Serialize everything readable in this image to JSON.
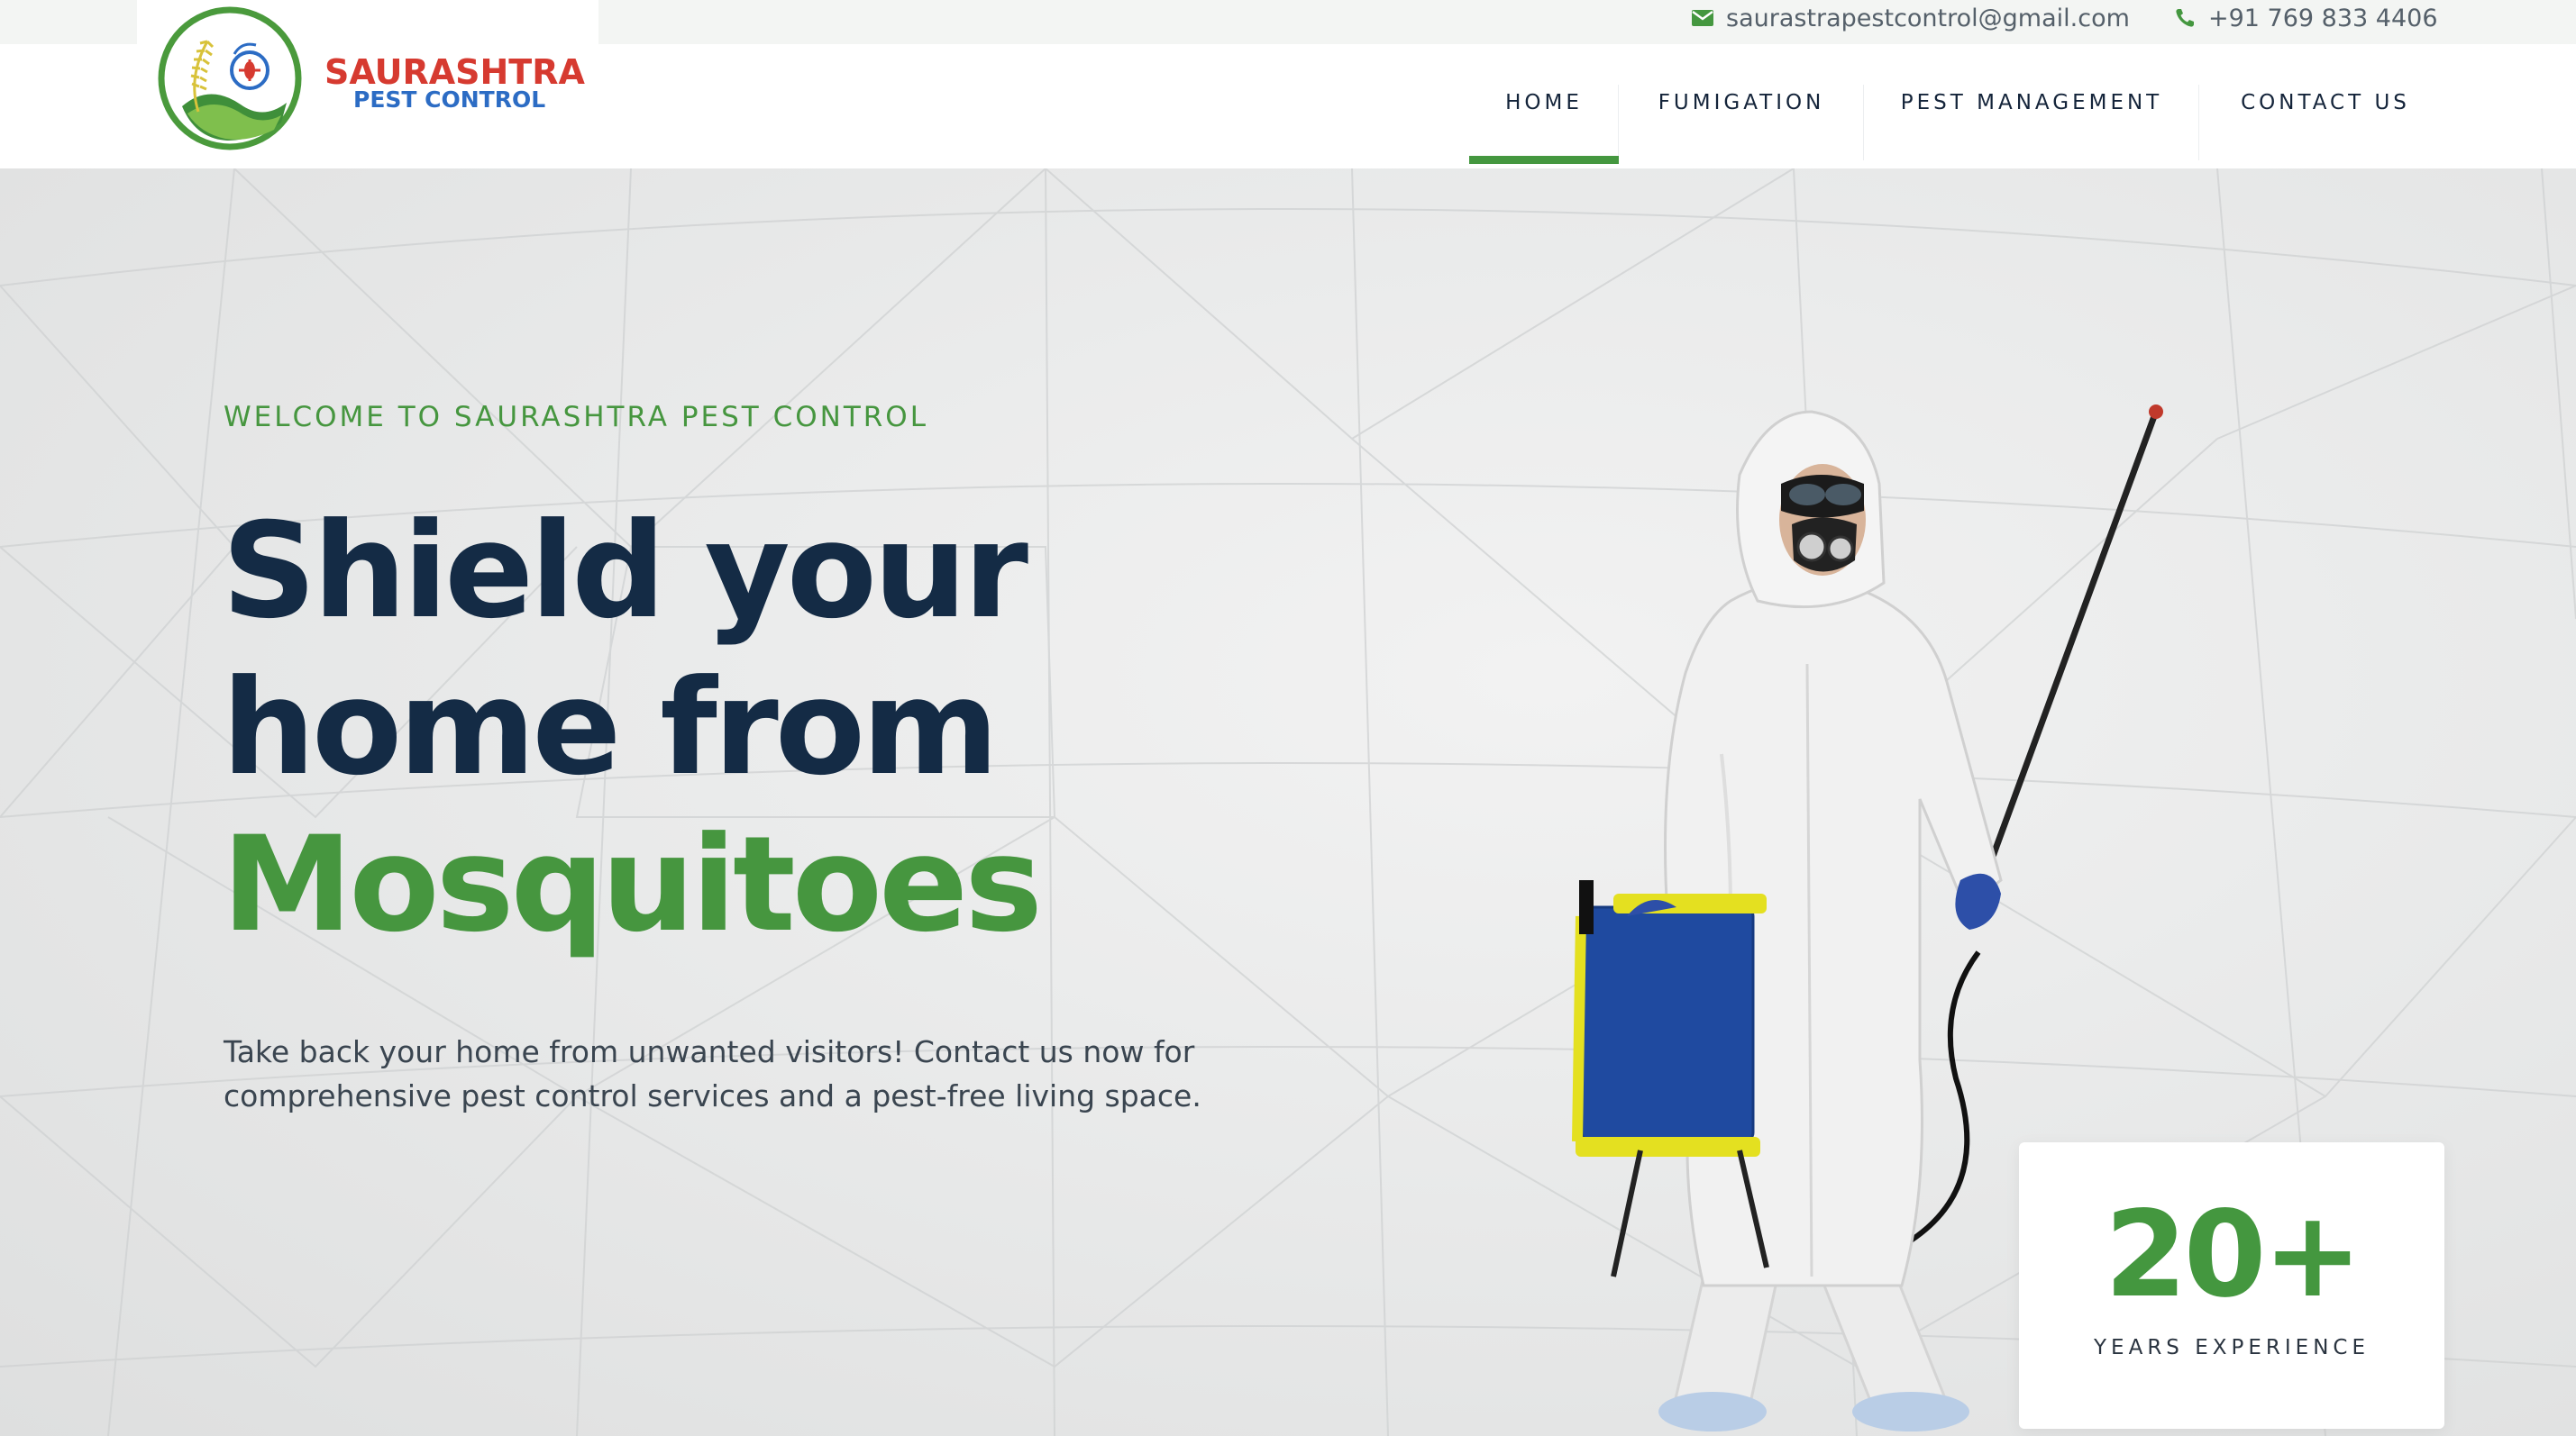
{
  "topbar": {
    "email": "saurastrapestcontrol@gmail.com",
    "phone": "+91 769 833 4406",
    "icons": {
      "email": "envelope-icon",
      "phone": "phone-icon"
    }
  },
  "logo": {
    "line1": "SAURASHTRA",
    "line2": "PEST CONTROL"
  },
  "nav": {
    "items": [
      {
        "label": "HOME",
        "active": true
      },
      {
        "label": "FUMIGATION",
        "active": false
      },
      {
        "label": "PEST MANAGEMENT",
        "active": false
      },
      {
        "label": "CONTACT US",
        "active": false
      }
    ]
  },
  "hero": {
    "eyebrow": "WELCOME TO SAURASHTRA PEST CONTROL",
    "headline_line1": "Shield your",
    "headline_line2": "home from",
    "headline_accent": "Mosquitoes",
    "description": "Take back your home from unwanted visitors! Contact us now for comprehensive pest control services and a pest-free living space."
  },
  "experience": {
    "number": "20+",
    "label": "YEARS EXPERIENCE"
  },
  "colors": {
    "brand_green": "#44973f",
    "navy": "#142b45",
    "logo_red": "#d63a30",
    "logo_blue": "#2c6cc4"
  }
}
